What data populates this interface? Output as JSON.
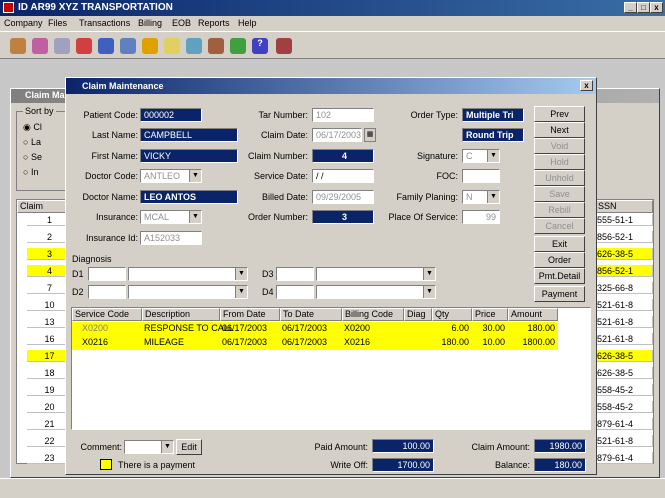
{
  "app": {
    "title": "ID AR99  XYZ TRANSPORTATION",
    "minimize": "_",
    "maximize": "□",
    "close": "x"
  },
  "menu": [
    "Company",
    "Files",
    "Transactions",
    "Billing",
    "EOB",
    "Reports",
    "Help"
  ],
  "toolbar_icons": [
    "people-icon",
    "group-icon",
    "network-icon",
    "umbrella-icon",
    "truck-icon",
    "book-icon",
    "pencil-icon",
    "card-icon",
    "monitor-icon",
    "vehicle-icon",
    "money-bag-icon",
    "help-icon",
    "exit-icon"
  ],
  "bg_window": {
    "title": "Claim Ma",
    "sort_label": "Sort by",
    "sort_options": [
      "Cl",
      "La",
      "Se",
      "In"
    ],
    "claim_header": "Claim",
    "ssn_header": "SSN",
    "claims": [
      "1",
      "2",
      "3",
      "4",
      "7",
      "10",
      "13",
      "16",
      "17",
      "18",
      "19",
      "20",
      "21",
      "22",
      "23"
    ],
    "ssns": [
      "555-51-1",
      "856-52-1",
      "626-38-5",
      "856-52-1",
      "325-66-8",
      "521-61-8",
      "521-61-8",
      "521-61-8",
      "626-38-5",
      "626-38-5",
      "558-45-2",
      "558-45-2",
      "879-61-4",
      "521-61-8",
      "879-61-4"
    ],
    "highlight_rows": [
      2,
      3,
      8
    ]
  },
  "claim_window": {
    "title": "Claim Maintenance",
    "close": "x",
    "labels": {
      "patient_code": "Patient Code:",
      "last_name": "Last Name:",
      "first_name": "First Name:",
      "doctor_code": "Doctor Code:",
      "doctor_name": "Doctor Name:",
      "insurance": "Insurance:",
      "insurance_id": "Insurance Id:",
      "tar_number": "Tar Number:",
      "claim_date": "Claim Date:",
      "claim_number": "Claim Number:",
      "service_date": "Service Date:",
      "billed_date": "Billed Date:",
      "order_number": "Order Number:",
      "order_type": "Order Type:",
      "signature": "Signature:",
      "foc": "FOC:",
      "family_planing": "Family Planing:",
      "place_of_service": "Place Of Service:",
      "diagnosis": "Diagnosis",
      "d1": "D1",
      "d2": "D2",
      "d3": "D3",
      "d4": "D4"
    },
    "values": {
      "patient_code": "000002",
      "last_name": "CAMPBELL",
      "first_name": "VICKY",
      "doctor_code": "ANTLEO",
      "doctor_name": "LEO ANTOS",
      "insurance": "MCAL",
      "insurance_id": "A152033",
      "tar_number": "102",
      "claim_date": "06/17/2003",
      "claim_number": "4",
      "service_date": " / /",
      "billed_date": "09/29/2005",
      "order_number": "3",
      "order_type": "Multiple Tri",
      "trip_type": "Round Trip",
      "signature": "C",
      "foc": "",
      "family_planing": "N",
      "place_of_service": "99"
    },
    "buttons": [
      "Prev",
      "Next",
      "Void",
      "Hold",
      "Unhold",
      "Save",
      "Rebill",
      "Cancel",
      "Exit",
      "Order",
      "Pmt.Detail",
      "Payment"
    ],
    "disabled_buttons": [
      2,
      3,
      4,
      5,
      6,
      7
    ],
    "table": {
      "headers": [
        "Service Code",
        "Description",
        "From Date",
        "To Date",
        "Billing Code",
        "Diag",
        "Qty",
        "Price",
        "Amount"
      ],
      "rows": [
        [
          "X0200",
          "RESPONSE TO CALL",
          "06/17/2003",
          "06/17/2003",
          "X0200",
          "",
          "6.00",
          "30.00",
          "180.00"
        ],
        [
          "X0216",
          "MILEAGE",
          "06/17/2003",
          "06/17/2003",
          "X0216",
          "",
          "180.00",
          "10.00",
          "1800.00"
        ]
      ]
    },
    "footer": {
      "comment_label": "Comment:",
      "edit_button": "Edit",
      "payment_note": "There is a payment",
      "paid_amount_label": "Paid Amount:",
      "paid_amount": "100.00",
      "write_off_label": "Write Off:",
      "write_off": "1700.00",
      "claim_amount_label": "Claim Amount:",
      "claim_amount": "1980.00",
      "balance_label": "Balance:",
      "balance": "180.00"
    }
  },
  "colors": {
    "navy": "#0a246a",
    "highlight": "#ffff00",
    "window": "#d4d0c8"
  }
}
